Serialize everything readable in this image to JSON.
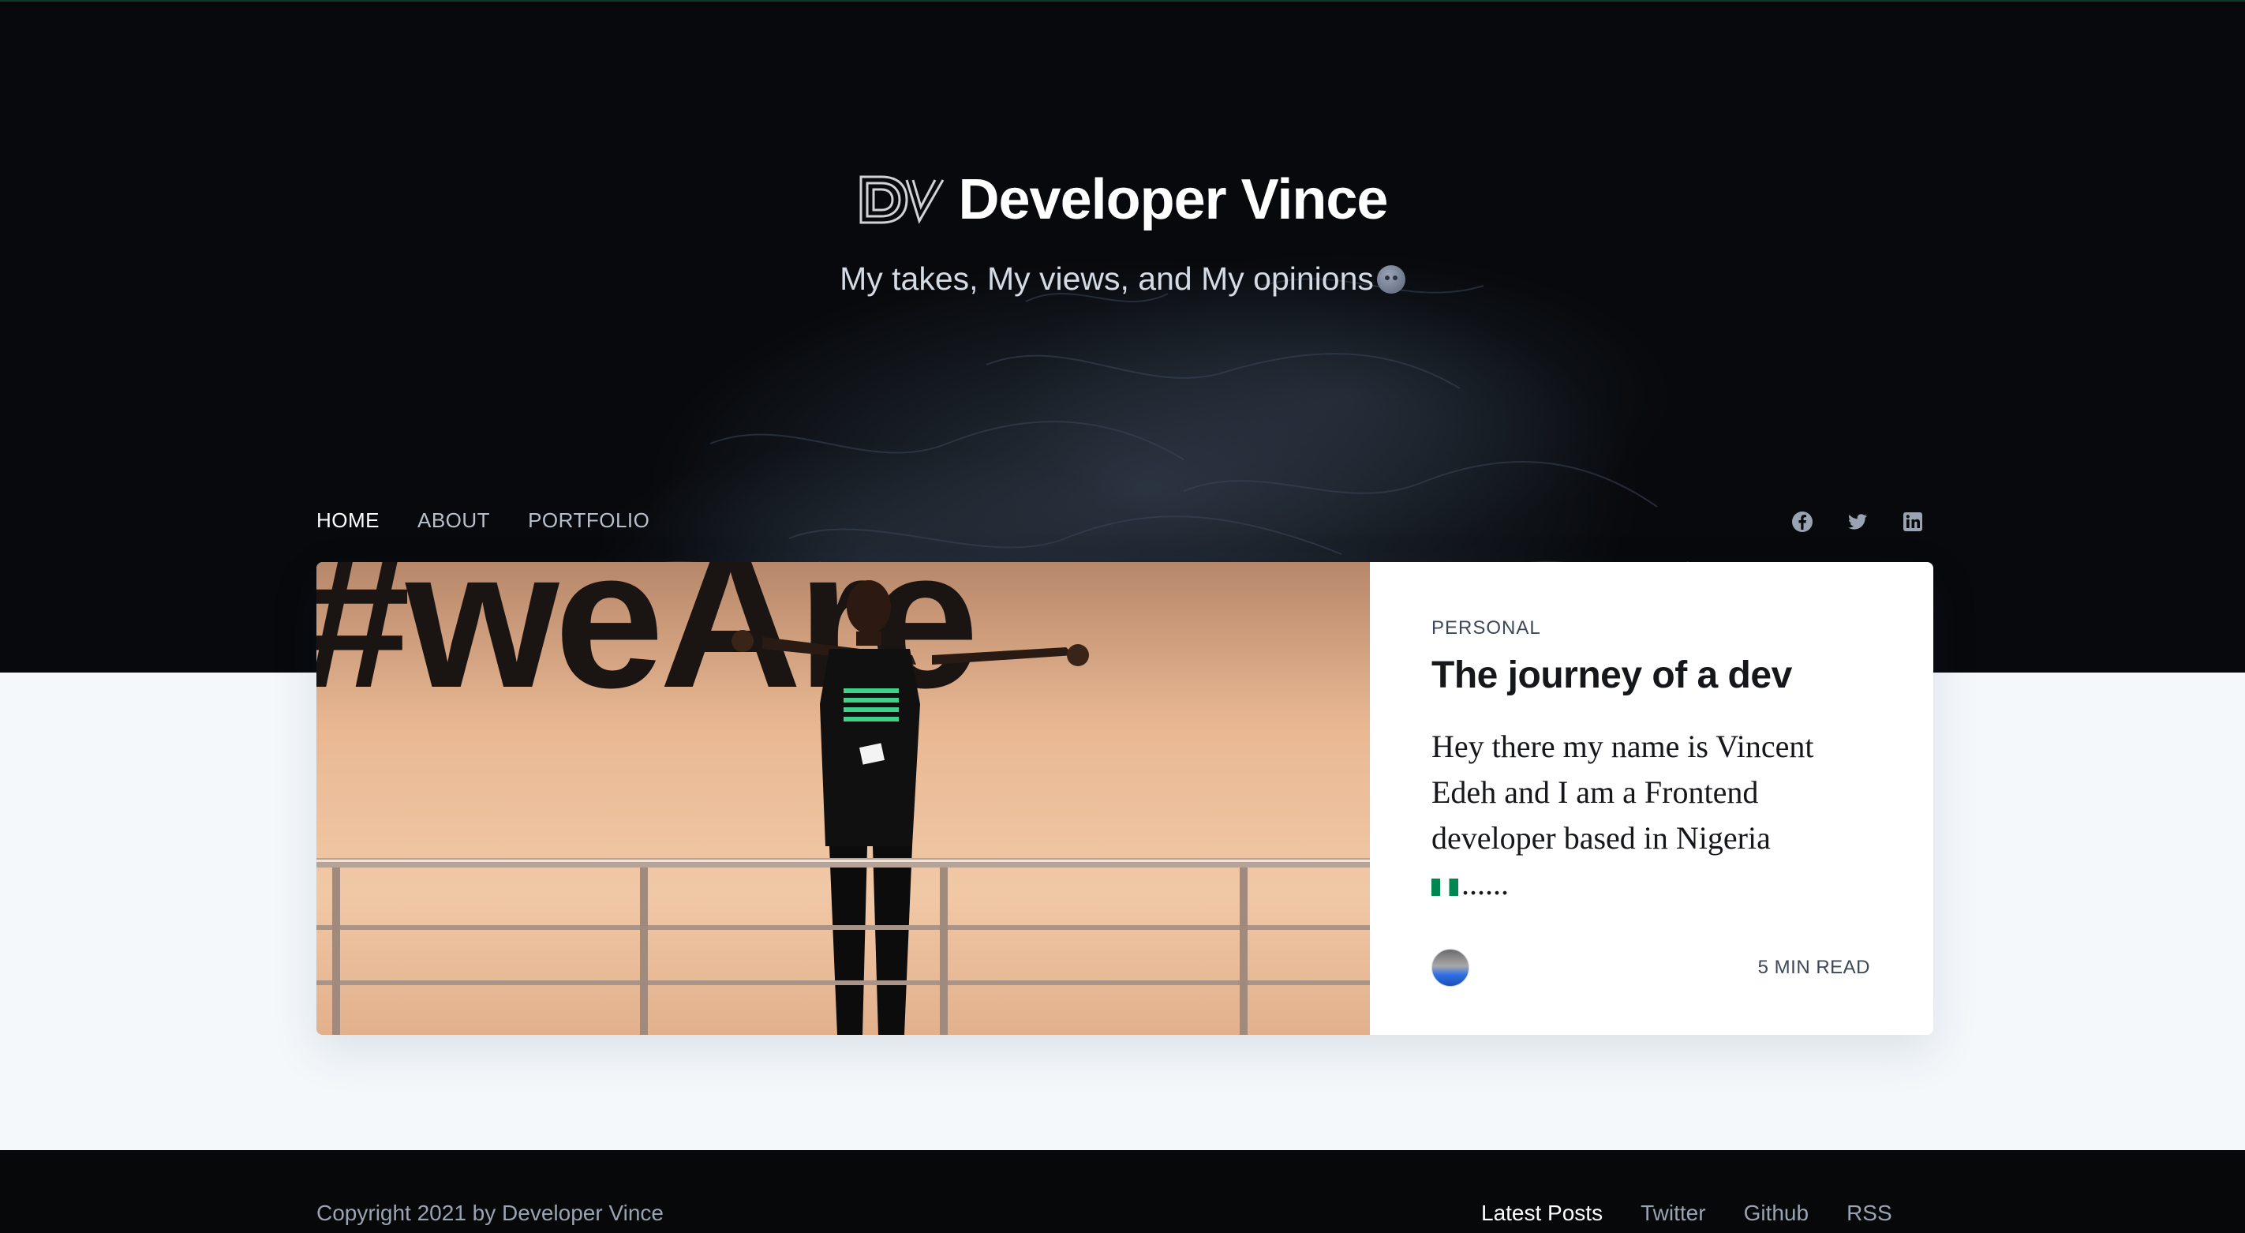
{
  "site": {
    "title": "Developer Vince",
    "logo_text": "DV",
    "tagline": "My takes, My views, and My opinions"
  },
  "nav": {
    "items": [
      {
        "label": "HOME",
        "active": true
      },
      {
        "label": "ABOUT",
        "active": false
      },
      {
        "label": "PORTFOLIO",
        "active": false
      }
    ]
  },
  "social": [
    "facebook-icon",
    "twitter-icon",
    "linkedin-icon"
  ],
  "post": {
    "tag": "PERSONAL",
    "title": "The journey of a dev",
    "excerpt": "Hey there my name is Vincent Edeh and I am a Frontend developer based in Nigeria",
    "excerpt_tail": "......",
    "read_time": "5 MIN READ",
    "image_text": "#weAre"
  },
  "footer": {
    "copyright": "Copyright 2021 by Developer Vince",
    "links": [
      "Latest Posts",
      "Twitter",
      "Github",
      "RSS"
    ]
  },
  "colors": {
    "hero_bg": "#07090c",
    "page_bg": "#f4f8fb",
    "footer_bg": "#070809",
    "flag_green": "#008751"
  }
}
